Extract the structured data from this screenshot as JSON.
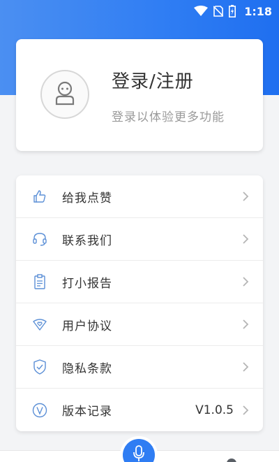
{
  "status_bar": {
    "time": "1:18",
    "icons": [
      "wifi-icon",
      "sim-off-icon",
      "battery-charging-icon"
    ]
  },
  "profile": {
    "title": "登录/注册",
    "subtitle": "登录以体验更多功能",
    "avatar_icon": "user-avatar-icon"
  },
  "menu": {
    "items": [
      {
        "label": "给我点赞",
        "icon": "thumbs-up-icon",
        "value": ""
      },
      {
        "label": "联系我们",
        "icon": "headset-icon",
        "value": ""
      },
      {
        "label": "打小报告",
        "icon": "clipboard-icon",
        "value": ""
      },
      {
        "label": "用户协议",
        "icon": "heart-shield-icon",
        "value": ""
      },
      {
        "label": "隐私条款",
        "icon": "shield-check-icon",
        "value": ""
      },
      {
        "label": "版本记录",
        "icon": "version-v-icon",
        "value": "V1.0.5"
      }
    ]
  },
  "bottom_nav": {
    "center_icon": "microphone-icon"
  },
  "colors": {
    "primary": "#2f7df3",
    "icon_stroke": "#5b8fd6",
    "text": "#333333",
    "subtext": "#9a9a9a"
  }
}
